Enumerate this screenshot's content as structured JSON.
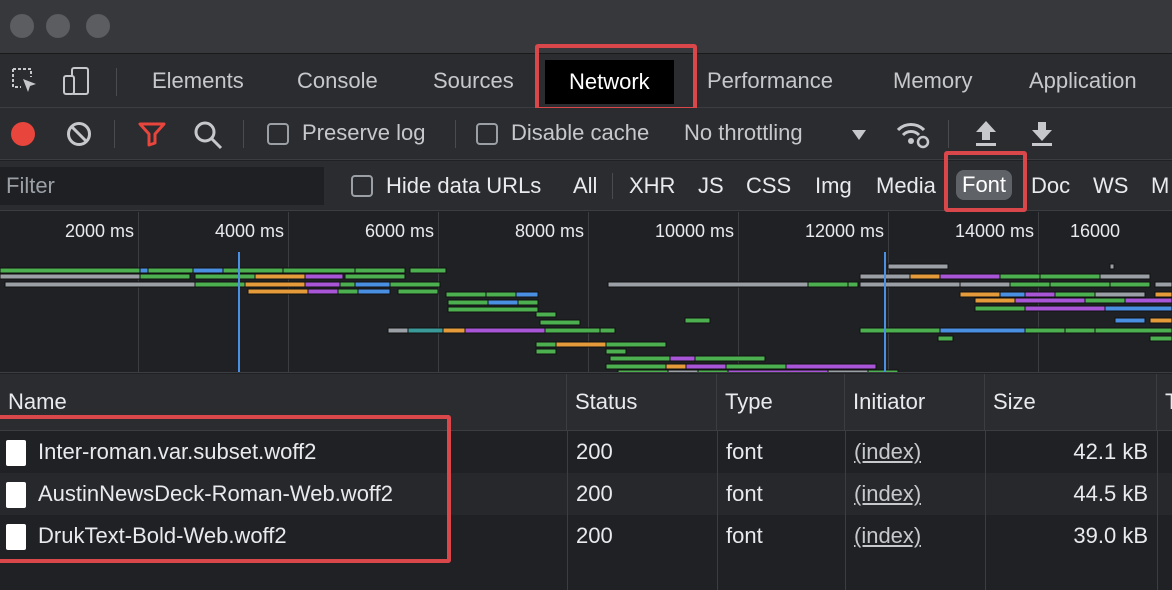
{
  "tabs": [
    "Elements",
    "Console",
    "Sources",
    "Network",
    "Performance",
    "Memory",
    "Application"
  ],
  "active_tab": "Network",
  "toolbar": {
    "preserve_log": "Preserve log",
    "disable_cache": "Disable cache",
    "throttling": "No throttling"
  },
  "filter": {
    "placeholder": "Filter",
    "hide_data_urls": "Hide data URLs",
    "types": [
      "All",
      "XHR",
      "JS",
      "CSS",
      "Img",
      "Media",
      "Font",
      "Doc",
      "WS",
      "M"
    ],
    "active_type": "Font"
  },
  "timeline": {
    "ticks": [
      "2000 ms",
      "4000 ms",
      "6000 ms",
      "8000 ms",
      "10000 ms",
      "12000 ms",
      "14000 ms",
      "16000"
    ]
  },
  "table": {
    "columns": [
      "Name",
      "Status",
      "Type",
      "Initiator",
      "Size",
      "T"
    ],
    "rows": [
      {
        "name": "Inter-roman.var.subset.woff2",
        "status": "200",
        "type": "font",
        "initiator": "(index)",
        "size": "42.1 kB"
      },
      {
        "name": "AustinNewsDeck-Roman-Web.woff2",
        "status": "200",
        "type": "font",
        "initiator": "(index)",
        "size": "44.5 kB"
      },
      {
        "name": "DrukText-Bold-Web.woff2",
        "status": "200",
        "type": "font",
        "initiator": "(index)",
        "size": "39.0 kB"
      }
    ]
  },
  "colors": {
    "highlight": "#d9474b",
    "record": "#e8453c",
    "filter_icon": "#e8453c",
    "bar_green": "#4caf50",
    "bar_blue": "#4a90e2",
    "bar_orange": "#e59b3a",
    "bar_purple": "#a855d8",
    "bar_gray": "#9aa0a6",
    "bar_teal": "#3a9a9a"
  }
}
